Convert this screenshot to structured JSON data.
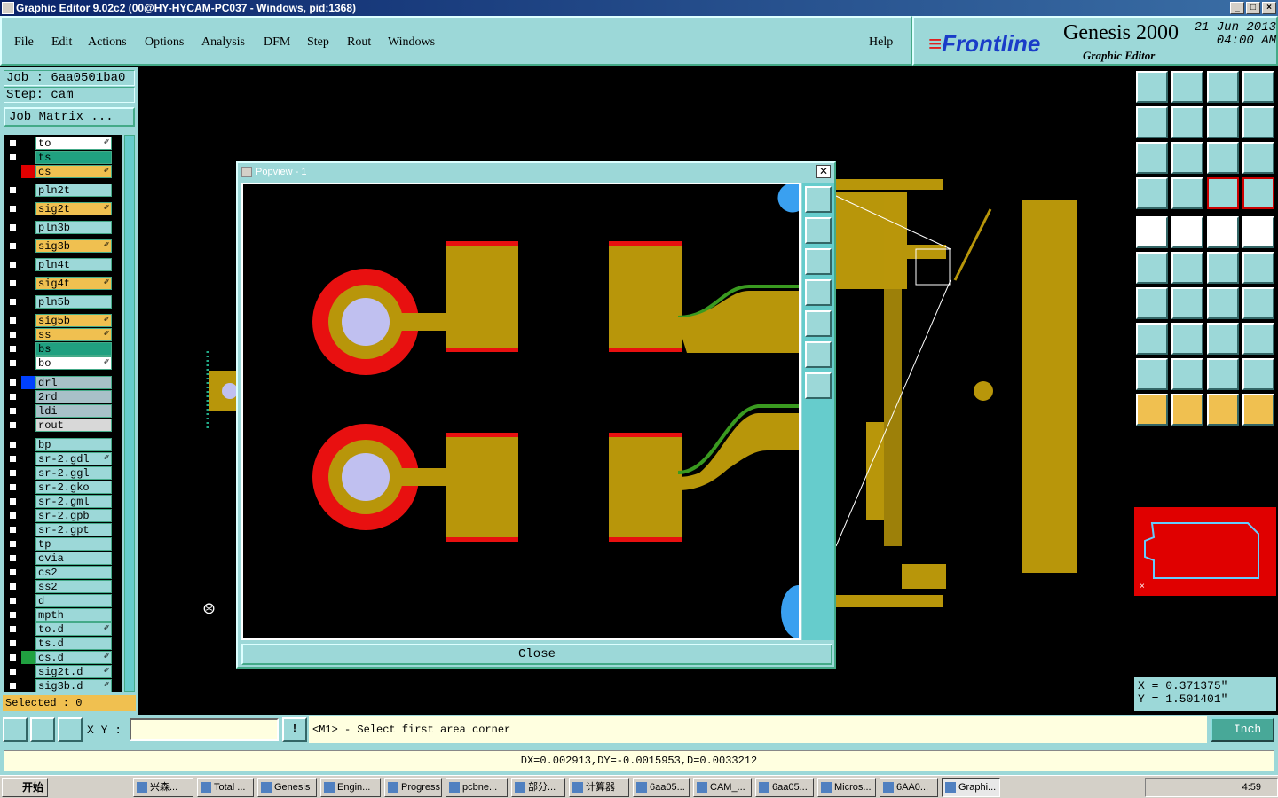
{
  "window": {
    "title": "Graphic Editor 9.02c2 (00@HY-HYCAM-PC037 - Windows, pid:1368)"
  },
  "menu": {
    "items": [
      "File",
      "Edit",
      "Actions",
      "Options",
      "Analysis",
      "DFM",
      "Step",
      "Rout",
      "Windows"
    ],
    "help": "Help"
  },
  "brand": {
    "logo_red": "≡",
    "logo": "Frontline",
    "product": "Genesis 2000",
    "subtitle": "Graphic Editor",
    "date": "21 Jun 2013",
    "time": "04:00 AM"
  },
  "job": {
    "job_label": "Job : 6aa0501ba0",
    "step_label": "Step: cam",
    "matrix_button": "Job Matrix ..."
  },
  "layers": [
    {
      "name": "to",
      "color": "#ffffff",
      "swatch": "#000000",
      "edit": true
    },
    {
      "name": "ts",
      "color": "#20a080",
      "swatch": "#000000",
      "edit": false
    },
    {
      "name": "cs",
      "color": "#f0c050",
      "swatch": "#e00000",
      "edit": true,
      "checked": true
    },
    {
      "name": "pln2t",
      "color": "#9cd8d8",
      "swatch": "#000000",
      "edit": false
    },
    {
      "name": "sig2t",
      "color": "#f0c050",
      "swatch": "#000000",
      "edit": true
    },
    {
      "name": "pln3b",
      "color": "#9cd8d8",
      "swatch": "#000000",
      "edit": false
    },
    {
      "name": "sig3b",
      "color": "#f0c050",
      "swatch": "#000000",
      "edit": true
    },
    {
      "name": "pln4t",
      "color": "#9cd8d8",
      "swatch": "#000000",
      "edit": false
    },
    {
      "name": "sig4t",
      "color": "#f0c050",
      "swatch": "#000000",
      "edit": true
    },
    {
      "name": "pln5b",
      "color": "#9cd8d8",
      "swatch": "#000000",
      "edit": false
    },
    {
      "name": "sig5b",
      "color": "#f0c050",
      "swatch": "#000000",
      "edit": true
    },
    {
      "name": "ss",
      "color": "#f0c050",
      "swatch": "#000000",
      "edit": true
    },
    {
      "name": "bs",
      "color": "#20a080",
      "swatch": "#000000",
      "edit": false
    },
    {
      "name": "bo",
      "color": "#ffffff",
      "swatch": "#000000",
      "edit": true
    },
    {
      "name": "drl",
      "color": "#a8c0c8",
      "swatch": "#0040ff",
      "edit": false
    },
    {
      "name": "2rd",
      "color": "#a8c0c8",
      "swatch": "#000000",
      "edit": false
    },
    {
      "name": "ldi",
      "color": "#a8c0c8",
      "swatch": "#000000",
      "edit": false
    },
    {
      "name": "rout",
      "color": "#d8d8d8",
      "swatch": "#000000",
      "edit": false
    },
    {
      "name": "bp",
      "color": "#9cd8d8",
      "swatch": "#000000",
      "edit": false
    },
    {
      "name": "sr-2.gdl",
      "color": "#9cd8d8",
      "swatch": "#000000",
      "edit": true
    },
    {
      "name": "sr-2.ggl",
      "color": "#9cd8d8",
      "swatch": "#000000",
      "edit": false
    },
    {
      "name": "sr-2.gko",
      "color": "#9cd8d8",
      "swatch": "#000000",
      "edit": false
    },
    {
      "name": "sr-2.gml",
      "color": "#9cd8d8",
      "swatch": "#000000",
      "edit": false
    },
    {
      "name": "sr-2.gpb",
      "color": "#9cd8d8",
      "swatch": "#000000",
      "edit": false
    },
    {
      "name": "sr-2.gpt",
      "color": "#9cd8d8",
      "swatch": "#000000",
      "edit": false
    },
    {
      "name": "tp",
      "color": "#9cd8d8",
      "swatch": "#000000",
      "edit": false
    },
    {
      "name": "cvia",
      "color": "#9cd8d8",
      "swatch": "#000000",
      "edit": false
    },
    {
      "name": "cs2",
      "color": "#9cd8d8",
      "swatch": "#000000",
      "edit": false
    },
    {
      "name": "ss2",
      "color": "#9cd8d8",
      "swatch": "#000000",
      "edit": false
    },
    {
      "name": "d",
      "color": "#9cd8d8",
      "swatch": "#000000",
      "edit": false
    },
    {
      "name": "mpth",
      "color": "#9cd8d8",
      "swatch": "#000000",
      "edit": false
    },
    {
      "name": "to.d",
      "color": "#9cd8d8",
      "swatch": "#000000",
      "edit": true
    },
    {
      "name": "ts.d",
      "color": "#9cd8d8",
      "swatch": "#000000",
      "edit": false
    },
    {
      "name": "cs.d",
      "color": "#9cd8d8",
      "swatch": "#20a040",
      "edit": true
    },
    {
      "name": "sig2t.d",
      "color": "#9cd8d8",
      "swatch": "#000000",
      "edit": true
    },
    {
      "name": "sig3b.d",
      "color": "#9cd8d8",
      "swatch": "#000000",
      "edit": true
    }
  ],
  "selected": "Selected : 0",
  "popview": {
    "title": "Popview - 1",
    "close_x": "✕",
    "close_button": "Close"
  },
  "coords": {
    "x": "X = 0.371375\"",
    "y": "Y = 1.501401\""
  },
  "command": {
    "xy_label": "X Y :",
    "xy_value": "",
    "prompt": "<M1> - Select first area corner",
    "units": "Inch",
    "excl": "!"
  },
  "status": {
    "measure": "DX=0.002913,DY=-0.0015953,D=0.0033212"
  },
  "taskbar": {
    "start": "开始",
    "tasks": [
      "兴森...",
      "Total ...",
      "Genesis",
      "Engin...",
      "Progress",
      "pcbne...",
      "部分...",
      "计算器",
      "6aa05...",
      "CAM_...",
      "6aa05...",
      "Micros...",
      "6AA0...",
      "Graphi..."
    ],
    "clock": "4:59"
  },
  "colors": {
    "panel": "#9cd8d8",
    "copper": "#b8960a",
    "mask": "#e81010",
    "drill": "#c0c0f0"
  }
}
